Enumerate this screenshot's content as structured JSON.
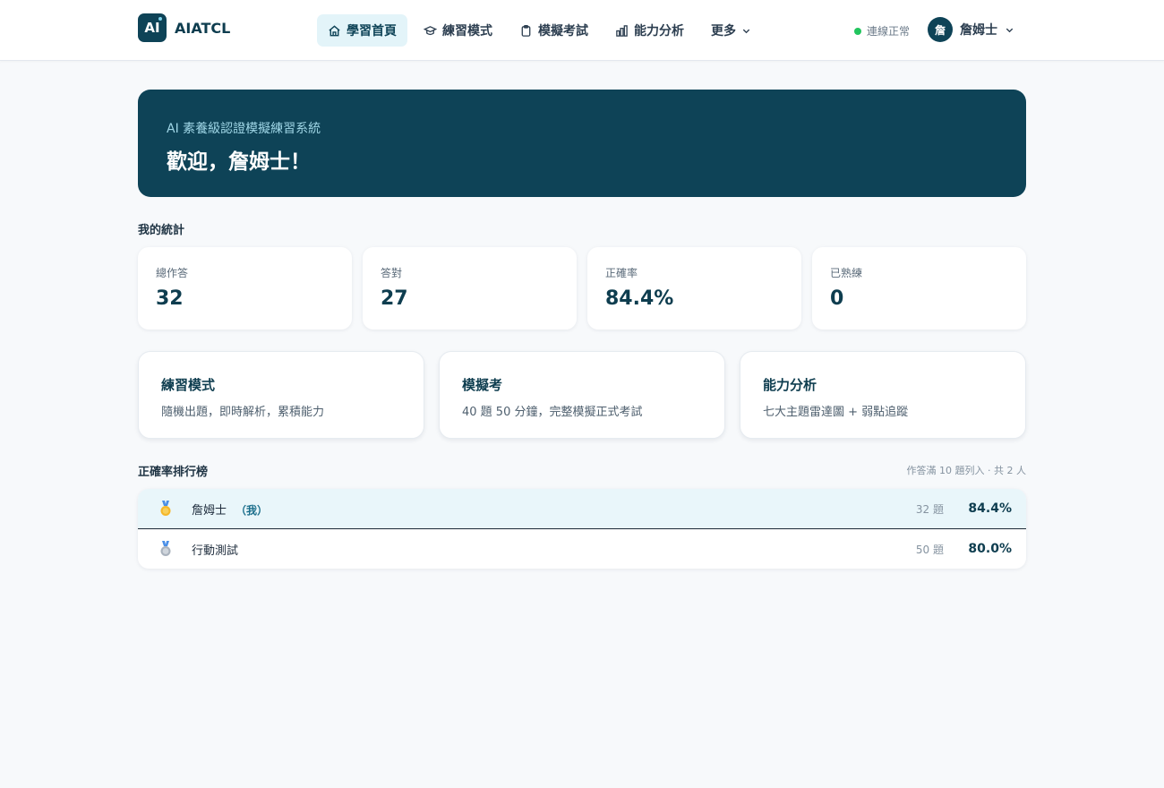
{
  "brand": {
    "logo_text": "AI",
    "name": "AIATCL"
  },
  "nav": {
    "items": [
      {
        "label": "學習首頁",
        "icon": "home-icon",
        "active": true
      },
      {
        "label": "練習模式",
        "icon": "graduation-cap-icon",
        "active": false
      },
      {
        "label": "模擬考試",
        "icon": "clipboard-icon",
        "active": false
      },
      {
        "label": "能力分析",
        "icon": "bar-chart-icon",
        "active": false
      },
      {
        "label": "更多",
        "icon": "chevron-down-icon",
        "active": false
      }
    ]
  },
  "status": {
    "label": "連線正常",
    "color": "#22c55e"
  },
  "user": {
    "avatar_text": "詹",
    "name": "詹姆士"
  },
  "hero": {
    "subtitle": "AI 素養級認證模擬練習系統",
    "title": "歡迎，詹姆士！"
  },
  "stats": {
    "title": "我的統計",
    "items": [
      {
        "label": "總作答",
        "value": "32"
      },
      {
        "label": "答對",
        "value": "27"
      },
      {
        "label": "正確率",
        "value": "84.4%"
      },
      {
        "label": "已熟練",
        "value": "0"
      }
    ]
  },
  "modes": [
    {
      "title": "練習模式",
      "desc": "隨機出題，即時解析，累積能力"
    },
    {
      "title": "模擬考",
      "desc": "40 題 50 分鐘，完整模擬正式考試"
    },
    {
      "title": "能力分析",
      "desc": "七大主題雷達圖 + 弱點追蹤"
    }
  ],
  "leaderboard": {
    "title": "正確率排行榜",
    "note": "作答滿 10 題列入 · 共 2 人",
    "me_tag": "（我）",
    "rows": [
      {
        "medal": "gold-medal-icon",
        "name": "詹姆士",
        "is_me": true,
        "count": "32 題",
        "rate": "84.4%"
      },
      {
        "medal": "silver-medal-icon",
        "name": "行動測試",
        "is_me": false,
        "count": "50 題",
        "rate": "80.0%"
      }
    ]
  },
  "colors": {
    "primary": "#0e4357",
    "accent_bg": "#e3f4f9",
    "page_bg": "#f7f9fb"
  }
}
